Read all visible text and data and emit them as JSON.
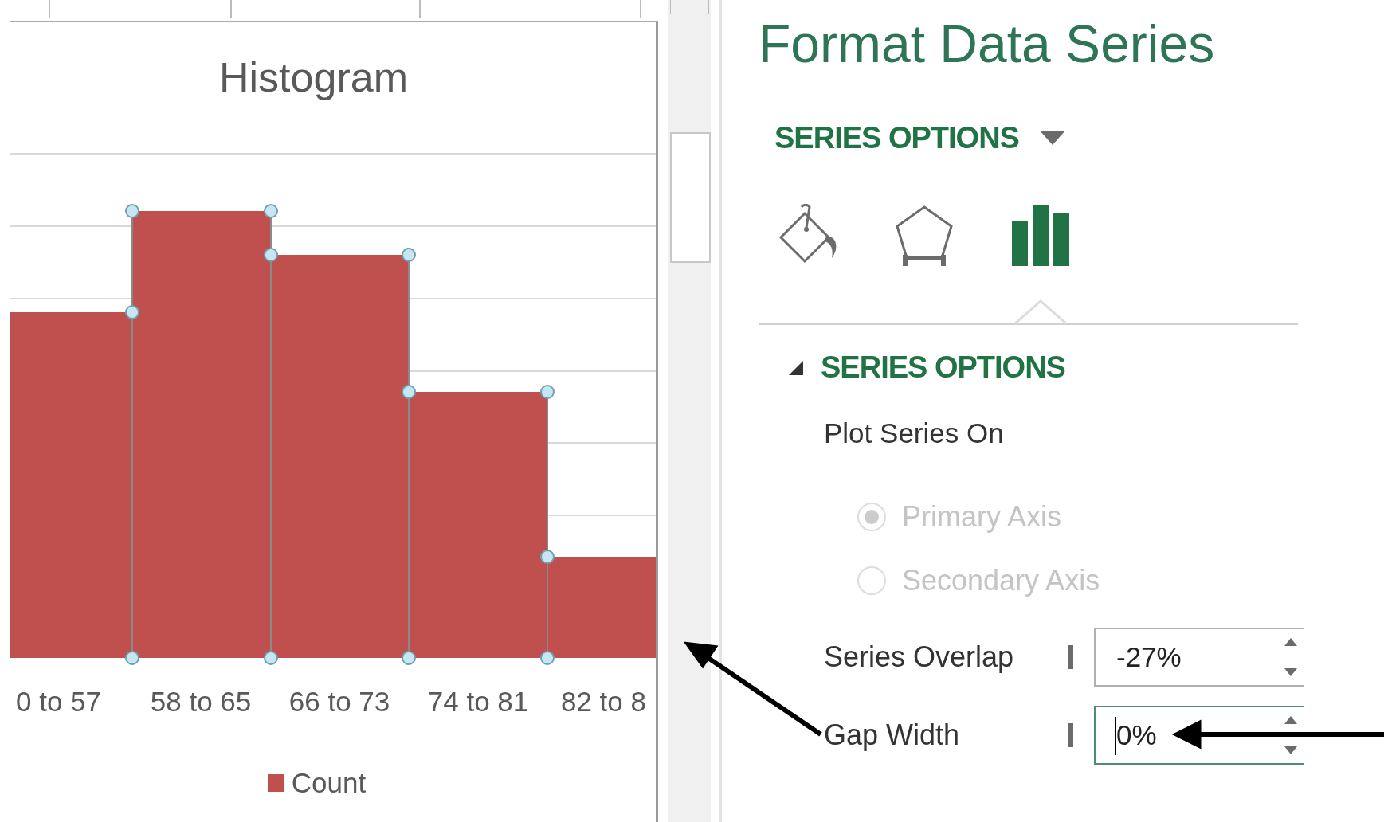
{
  "chart": {
    "title": "Histogram",
    "selected": true,
    "categories": [
      "0 to 57",
      "58 to 65",
      "66 to 73",
      "74 to 81",
      "82 to 8"
    ],
    "legend": [
      {
        "label": "Count",
        "color": "#c0504d"
      }
    ]
  },
  "panel": {
    "title": "Format Data Series",
    "options_menu": "SERIES OPTIONS",
    "tabs": [
      {
        "kind": "fill",
        "selected": false
      },
      {
        "kind": "effects",
        "selected": false
      },
      {
        "kind": "series",
        "selected": true
      }
    ],
    "section": {
      "title": "SERIES OPTIONS",
      "expanded": true,
      "label": "Plot Series On",
      "radios": [
        {
          "label": "Primary Axis",
          "selected": true,
          "disabled": true
        },
        {
          "label": "Secondary Axis",
          "selected": false,
          "disabled": true
        }
      ],
      "spinners": [
        {
          "label": "Series Overlap",
          "value": "-27%",
          "focused": false
        },
        {
          "label": "Gap Width",
          "value": "0%",
          "focused": true
        }
      ]
    }
  }
}
